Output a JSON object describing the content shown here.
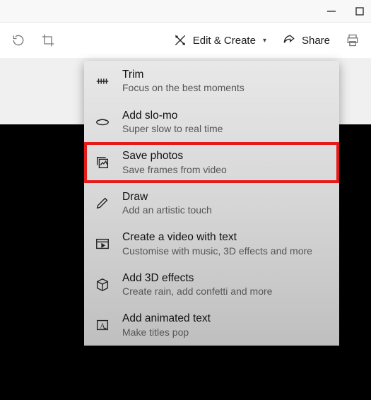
{
  "toolbar": {
    "edit_create_label": "Edit & Create",
    "share_label": "Share"
  },
  "menu": {
    "items": [
      {
        "title": "Trim",
        "subtitle": "Focus on the best moments"
      },
      {
        "title": "Add slo-mo",
        "subtitle": "Super slow to real time"
      },
      {
        "title": "Save photos",
        "subtitle": "Save frames from video"
      },
      {
        "title": "Draw",
        "subtitle": "Add an artistic touch"
      },
      {
        "title": "Create a video with text",
        "subtitle": "Customise with music, 3D effects and more"
      },
      {
        "title": "Add 3D effects",
        "subtitle": "Create rain, add confetti and more"
      },
      {
        "title": "Add animated text",
        "subtitle": "Make titles pop"
      }
    ]
  }
}
